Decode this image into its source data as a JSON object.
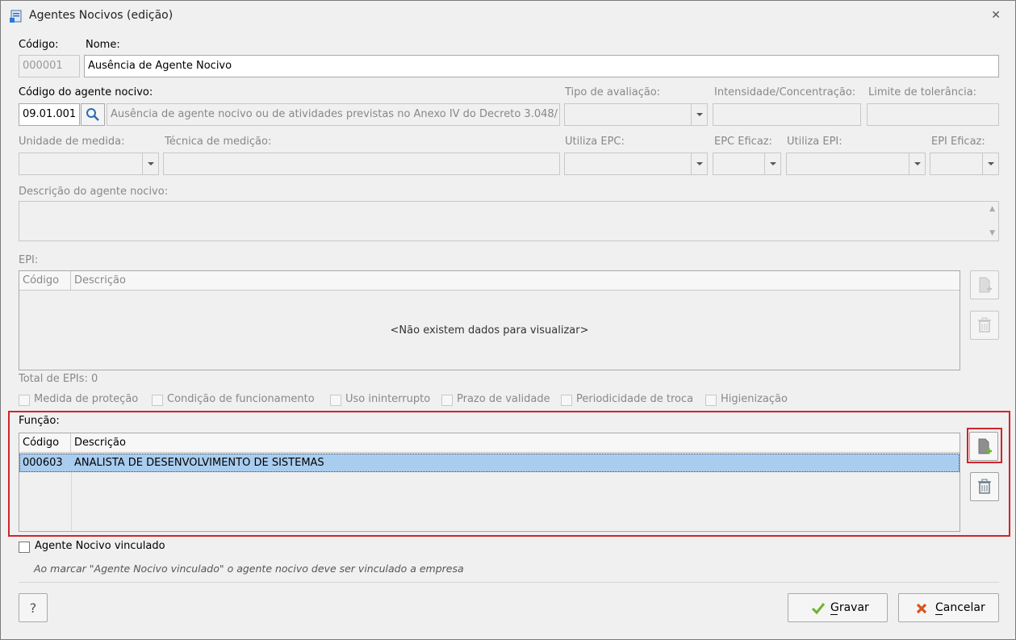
{
  "window": {
    "title": "Agentes Nocivos (edição)"
  },
  "form": {
    "codigo_label": "Código:",
    "codigo_value": "000001",
    "nome_label": "Nome:",
    "nome_value": "Ausência de Agente Nocivo",
    "codigo_agente_label": "Código do agente nocivo:",
    "codigo_agente_value": "09.01.001",
    "codigo_agente_desc": "Ausência de agente nocivo ou de atividades previstas no Anexo IV do Decreto 3.048/",
    "tipo_avaliacao_label": "Tipo de avaliação:",
    "intensidade_label": "Intensidade/Concentração:",
    "limite_label": "Limite de tolerância:",
    "unidade_label": "Unidade de medida:",
    "tecnica_label": "Técnica de medição:",
    "utiliza_epc_label": "Utiliza EPC:",
    "epc_eficaz_label": "EPC Eficaz:",
    "utiliza_epi_label": "Utiliza EPI:",
    "epi_eficaz_label": "EPI Eficaz:",
    "descricao_label": "Descrição do agente nocivo:"
  },
  "epi": {
    "label": "EPI:",
    "columns": [
      "Código",
      "Descrição"
    ],
    "empty_text": "<Não existem dados para visualizar>",
    "total": "Total de EPIs: 0",
    "checks": [
      "Medida de proteção",
      "Condição de funcionamento",
      "Uso ininterrupto",
      "Prazo de validade",
      "Periodicidade de troca",
      "Higienização"
    ]
  },
  "funcao": {
    "label": "Função:",
    "columns": [
      "Código",
      "Descrição"
    ],
    "rows": [
      {
        "codigo": "000603",
        "descricao": "ANALISTA DE DESENVOLVIMENTO DE SISTEMAS"
      }
    ]
  },
  "vinculado": {
    "label": "Agente Nocivo vinculado",
    "hint": "Ao marcar \"Agente Nocivo vinculado\" o agente nocivo deve ser vinculado a empresa"
  },
  "buttons": {
    "help": "?",
    "save": "Gravar",
    "cancel": "Cancelar"
  },
  "colors": {
    "selection": "#a9cdef",
    "highlight_border": "#d0242b",
    "save_icon": "#6bb52f",
    "cancel_icon": "#d9531e"
  }
}
